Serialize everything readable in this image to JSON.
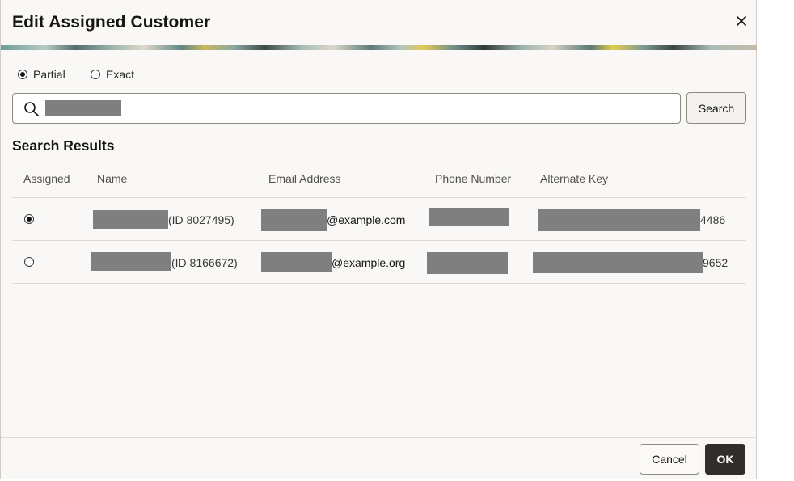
{
  "dialog": {
    "title": "Edit Assigned Customer",
    "close_label": "×"
  },
  "match_mode": {
    "options": [
      {
        "label": "Partial",
        "selected": true
      },
      {
        "label": "Exact",
        "selected": false
      }
    ]
  },
  "search": {
    "value": "",
    "button_label": "Search"
  },
  "results": {
    "title": "Search Results",
    "columns": [
      "Assigned",
      "Name",
      "Email Address",
      "Phone Number",
      "Alternate Key"
    ],
    "rows": [
      {
        "assigned": true,
        "name_suffix": "(ID 8027495)",
        "email_suffix": "@example.com",
        "alt_key_suffix": "4486"
      },
      {
        "assigned": false,
        "name_suffix": "(ID 8166672)",
        "email_suffix": "@example.org",
        "alt_key_suffix": "9652"
      }
    ]
  },
  "footer": {
    "cancel_label": "Cancel",
    "ok_label": "OK"
  },
  "colors": {
    "primary_button": "#312d2a",
    "redaction": "#7f7f7f",
    "background": "#f9f8f6"
  }
}
